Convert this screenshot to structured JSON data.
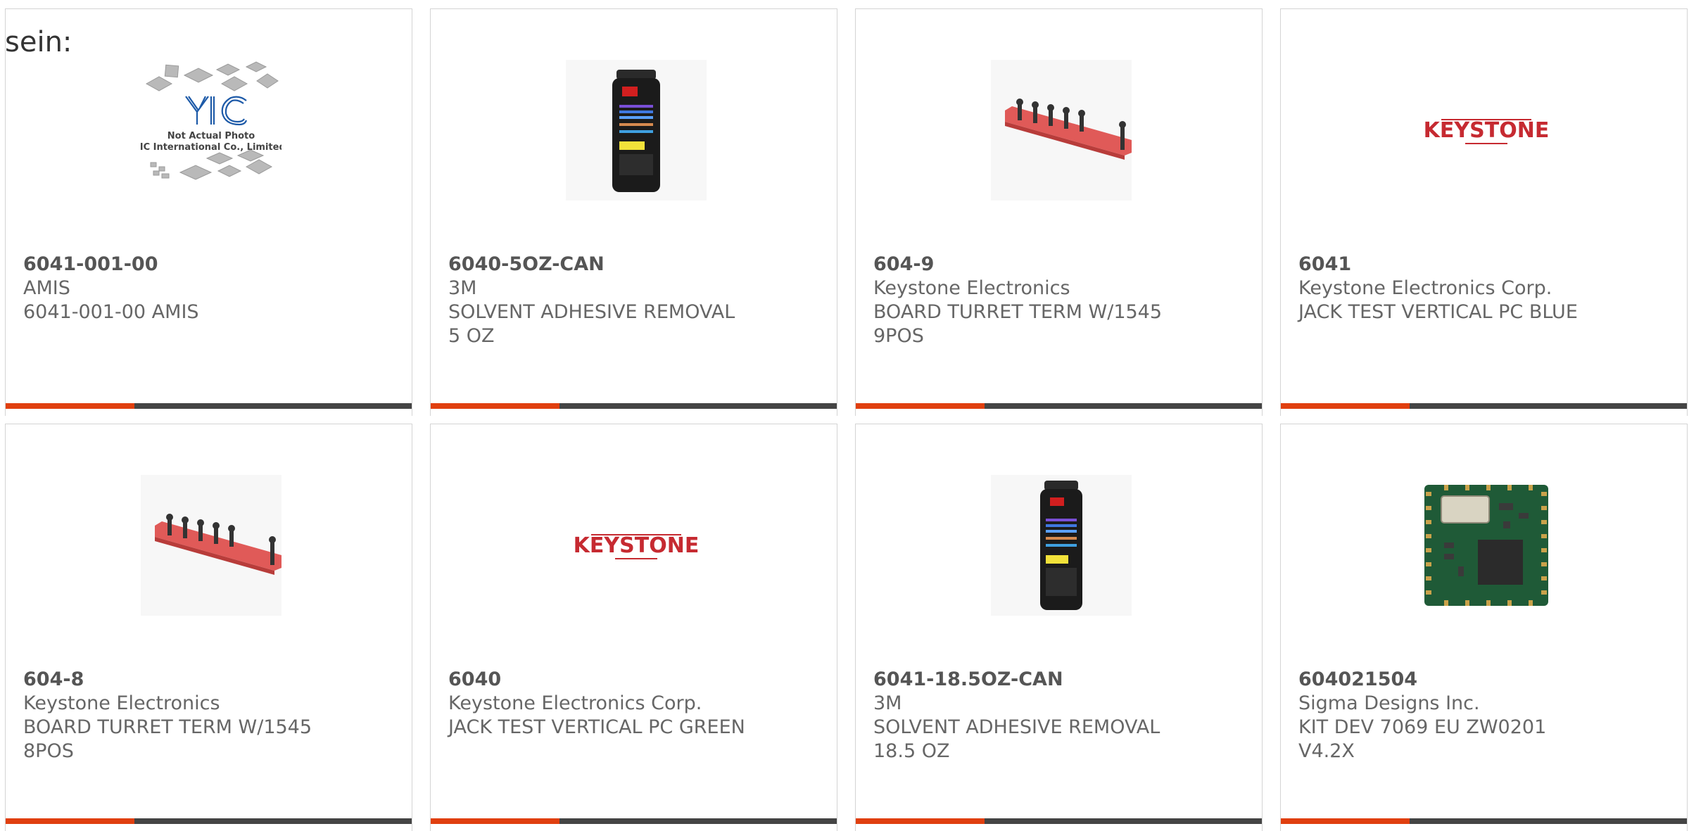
{
  "page": {
    "label": "sein:"
  },
  "colors": {
    "accent": "#e03f0f",
    "bar": "#444444",
    "text": "#666666"
  },
  "products": [
    {
      "part": "6041-001-00",
      "manufacturer": "AMIS",
      "description": "6041-001-00 AMIS",
      "image": "placeholder-photo",
      "photo_text": [
        "Not Actual Photo",
        "YIC International Co., Limited."
      ],
      "logo_text": "YIC"
    },
    {
      "part": "6040-5OZ-CAN",
      "manufacturer": "3M",
      "description": "SOLVENT ADHESIVE REMOVAL 5 OZ",
      "image": "spray-can"
    },
    {
      "part": "604-9",
      "manufacturer": "Keystone Electronics",
      "description": "BOARD TURRET TERM W/1545 9POS",
      "image": "turret-board"
    },
    {
      "part": "6041",
      "manufacturer": "Keystone Electronics Corp.",
      "description": "JACK TEST VERTICAL PC BLUE",
      "image": "keystone-logo",
      "logo_text": "KEYSTONE"
    },
    {
      "part": "604-8",
      "manufacturer": "Keystone Electronics",
      "description": "BOARD TURRET TERM W/1545 8POS",
      "image": "turret-board"
    },
    {
      "part": "6040",
      "manufacturer": "Keystone Electronics Corp.",
      "description": "JACK TEST VERTICAL PC GREEN",
      "image": "keystone-logo",
      "logo_text": "KEYSTONE"
    },
    {
      "part": "6041-18.5OZ-CAN",
      "manufacturer": "3M",
      "description": "SOLVENT ADHESIVE REMOVAL 18.5 OZ",
      "image": "spray-can"
    },
    {
      "part": "604021504",
      "manufacturer": "Sigma Designs Inc.",
      "description": "KIT DEV 7069 EU ZW0201 V4.2X",
      "image": "pcb-module"
    }
  ]
}
